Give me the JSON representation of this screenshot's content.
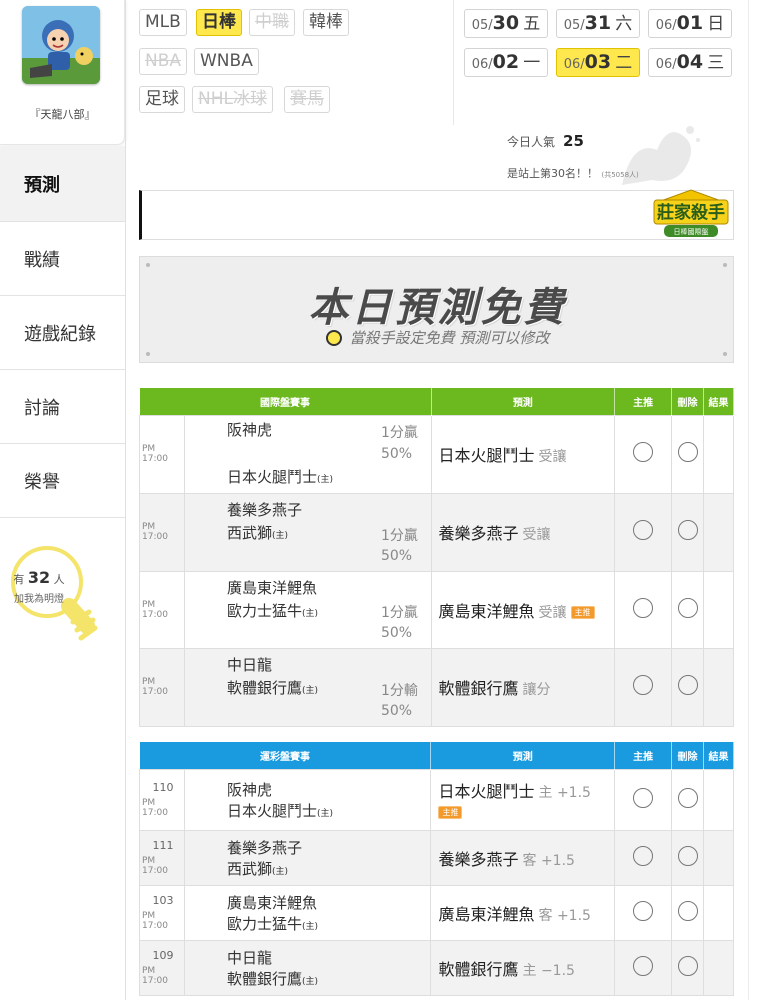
{
  "user": {
    "name": "『天龍八部』"
  },
  "nav": [
    {
      "label": "預測",
      "active": true
    },
    {
      "label": "戰績"
    },
    {
      "label": "遊戲紀錄"
    },
    {
      "label": "討論"
    },
    {
      "label": "榮譽"
    }
  ],
  "fans": {
    "prefix": "有",
    "count": "32",
    "suffix": "人",
    "caption": "加我為明燈"
  },
  "sports": [
    {
      "label": "MLB"
    },
    {
      "label": "日棒",
      "active": true
    },
    {
      "label": "中職",
      "disabled": true
    },
    {
      "label": "韓棒"
    },
    {
      "label": "NBA",
      "disabled": true
    },
    {
      "label": "WNBA"
    },
    {
      "label": "足球"
    },
    {
      "label": "NHL冰球",
      "disabled": true
    },
    {
      "label": "賽馬",
      "disabled": true
    }
  ],
  "dates": [
    {
      "md": "05/",
      "day": "30",
      "dow": "五"
    },
    {
      "md": "05/",
      "day": "31",
      "dow": "六"
    },
    {
      "md": "06/",
      "day": "01",
      "dow": "日"
    },
    {
      "md": "06/",
      "day": "02",
      "dow": "一"
    },
    {
      "md": "06/",
      "day": "03",
      "dow": "二",
      "active": true
    },
    {
      "md": "06/",
      "day": "04",
      "dow": "三"
    }
  ],
  "popularity": {
    "label": "今日人氣",
    "value": "25",
    "rank": "是站上第30名！！",
    "rank_note": "(共5058人)"
  },
  "badge": {
    "title": "莊家殺手",
    "subtitle": "日棒國際盤"
  },
  "banner": {
    "title": "本日預測免費",
    "subtitle": "當殺手設定免費 預測可以修改"
  },
  "intl": {
    "headers": [
      "國際盤賽事",
      "預測",
      "主推",
      "刪除",
      "結果"
    ],
    "header_color": "#6cb81f",
    "rows": [
      {
        "time": "PM 17:00",
        "away": "阪神虎",
        "home": "日本火腿鬥士",
        "home_mark": "(主)",
        "odds1": "1分贏",
        "odds2": "50%",
        "pick": "日本火腿鬥士",
        "kind": "受讓",
        "layout": "split"
      },
      {
        "time": "PM 17:00",
        "away": "養樂多燕子",
        "home": "西武獅",
        "home_mark": "(主)",
        "odds1": "1分贏",
        "odds2": "50%",
        "pick": "養樂多燕子",
        "kind": "受讓",
        "layout": "low"
      },
      {
        "time": "PM 17:00",
        "away": "廣島東洋鯉魚",
        "home": "歐力士猛牛",
        "home_mark": "(主)",
        "odds1": "1分贏",
        "odds2": "50%",
        "pick": "廣島東洋鯉魚",
        "kind": "受讓",
        "tag": "主推",
        "layout": "low"
      },
      {
        "time": "PM 17:00",
        "away": "中日龍",
        "home": "軟體銀行鷹",
        "home_mark": "(主)",
        "odds1": "1分輸",
        "odds2": "50%",
        "pick": "軟體銀行鷹",
        "kind": "讓分",
        "layout": "low"
      }
    ]
  },
  "lottery": {
    "headers": [
      "運彩盤賽事",
      "預測",
      "主推",
      "刪除",
      "結果"
    ],
    "header_color": "#1a9be0",
    "rows": [
      {
        "num": "110",
        "time": "PM 17:00",
        "away": "阪神虎",
        "home": "日本火腿鬥士",
        "home_mark": "(主)",
        "pick": "日本火腿鬥士",
        "kind": "主 +1.5",
        "tag": "主推"
      },
      {
        "num": "111",
        "time": "PM 17:00",
        "away": "養樂多燕子",
        "home": "西武獅",
        "home_mark": "(主)",
        "pick": "養樂多燕子",
        "kind": "客 +1.5"
      },
      {
        "num": "103",
        "time": "PM 17:00",
        "away": "廣島東洋鯉魚",
        "home": "歐力士猛牛",
        "home_mark": "(主)",
        "pick": "廣島東洋鯉魚",
        "kind": "客 +1.5"
      },
      {
        "num": "109",
        "time": "PM 17:00",
        "away": "中日龍",
        "home": "軟體銀行鷹",
        "home_mark": "(主)",
        "pick": "軟體銀行鷹",
        "kind": "主 −1.5"
      }
    ]
  }
}
